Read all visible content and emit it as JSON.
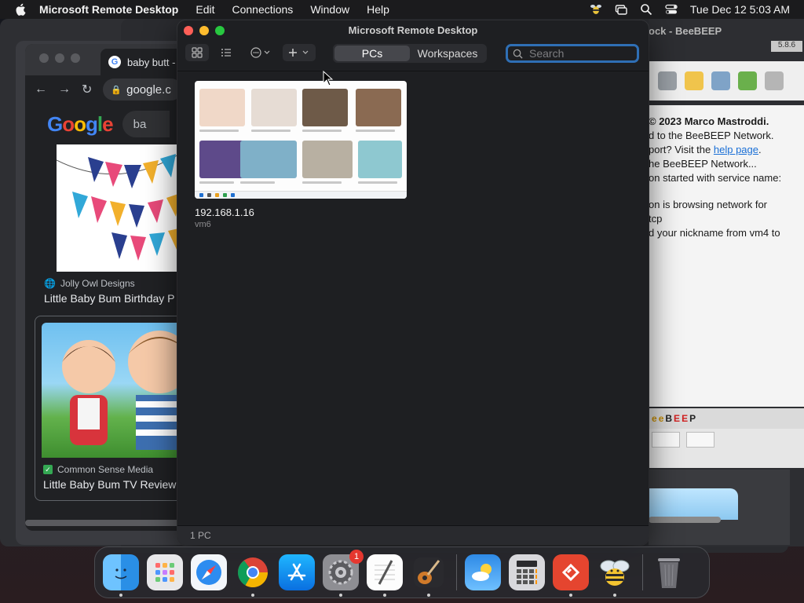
{
  "menubar": {
    "app_name": "Microsoft Remote Desktop",
    "items": [
      "Edit",
      "Connections",
      "Window",
      "Help"
    ],
    "datetime": "Tue Dec 12  5:03 AM"
  },
  "chrome": {
    "tab_title": "baby butt -",
    "address": "google.c",
    "search_prefix": "ba",
    "results": [
      {
        "source": "Jolly Owl Designs",
        "title": "Little Baby Bum Birthday P"
      },
      {
        "source": "Common Sense Media",
        "title": "Little Baby Bum TV Review"
      }
    ]
  },
  "beebeep": {
    "title": "ock - BeeBEEP",
    "version": "5.8.6",
    "log": {
      "line1": "© 2023 Marco Mastroddi.",
      "line2": "d to the BeeBEEP Network.",
      "line3_pre": "port? Visit the ",
      "line3_link": "help page",
      "line3_post": ".",
      "line4": "he BeeBEEP Network...",
      "line5": "on started with service name:",
      "line6": "on is browsing network for",
      "line7": "tcp",
      "line8": "d your nickname from vm4 to"
    },
    "brand": {
      "b": "e",
      "c": "e",
      "d": "B",
      "e": "E",
      "f": "E",
      "g": "P"
    }
  },
  "window": {
    "title": "Microsoft Remote Desktop",
    "tabs": [
      {
        "label": "PCs",
        "selected": true
      },
      {
        "label": "Workspaces",
        "selected": false
      }
    ],
    "search": {
      "placeholder": "Search",
      "value": ""
    },
    "pcs": [
      {
        "name": "192.168.1.16",
        "user": "vm6"
      }
    ],
    "status": "1 PC"
  },
  "dock": {
    "apps": [
      "Finder",
      "Launchpad",
      "Safari",
      "Google Chrome",
      "App Store",
      "System Settings",
      "TextEdit",
      "GarageBand",
      "Weather",
      "Calculator",
      "Microsoft Remote Desktop",
      "BeeBEEP",
      "Trash"
    ],
    "settings_badge": "1"
  },
  "colors": {
    "close": "#ff5f57",
    "minimize": "#febc2e",
    "zoom": "#28c840",
    "search_focus": "#2f6fb5"
  }
}
